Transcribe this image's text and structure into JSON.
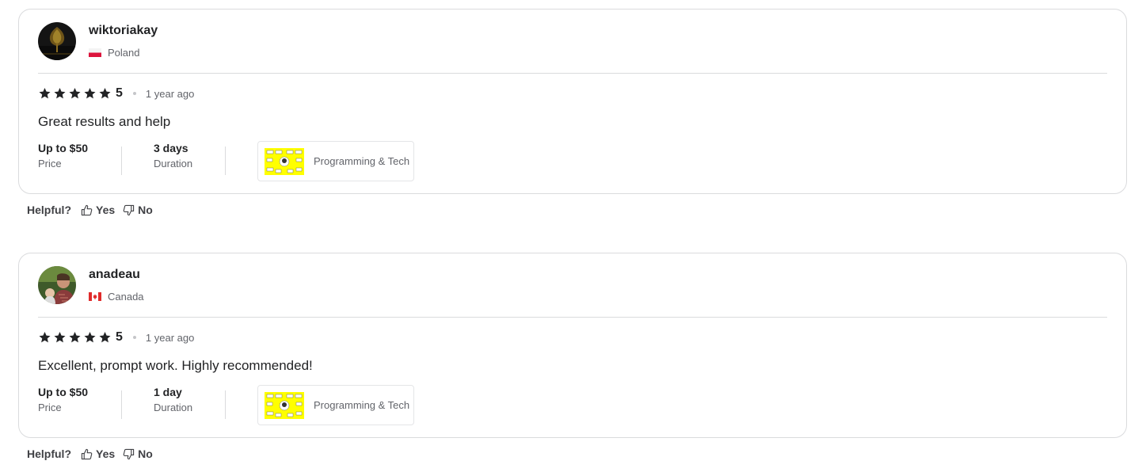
{
  "reviews": [
    {
      "username": "wiktoriakay",
      "country": "Poland",
      "flag": "poland-flag",
      "rating": "5",
      "stars": 5,
      "time_ago": "1 year ago",
      "text": "Great results and help",
      "price_value": "Up to $50",
      "price_label": "Price",
      "duration_value": "3 days",
      "duration_label": "Duration",
      "gig_category": "Programming & Tech"
    },
    {
      "username": "anadeau",
      "country": "Canada",
      "flag": "canada-flag",
      "rating": "5",
      "stars": 5,
      "time_ago": "1 year ago",
      "text": "Excellent, prompt work. Highly recommended!",
      "price_value": "Up to $50",
      "price_label": "Price",
      "duration_value": "1 day",
      "duration_label": "Duration",
      "gig_category": "Programming & Tech"
    }
  ],
  "helpful": {
    "label": "Helpful?",
    "yes_label": "Yes",
    "no_label": "No"
  },
  "colors": {
    "text": "#222325",
    "muted": "#62646a",
    "border": "#dadbdd",
    "thumb_bg": "#ffff00"
  }
}
